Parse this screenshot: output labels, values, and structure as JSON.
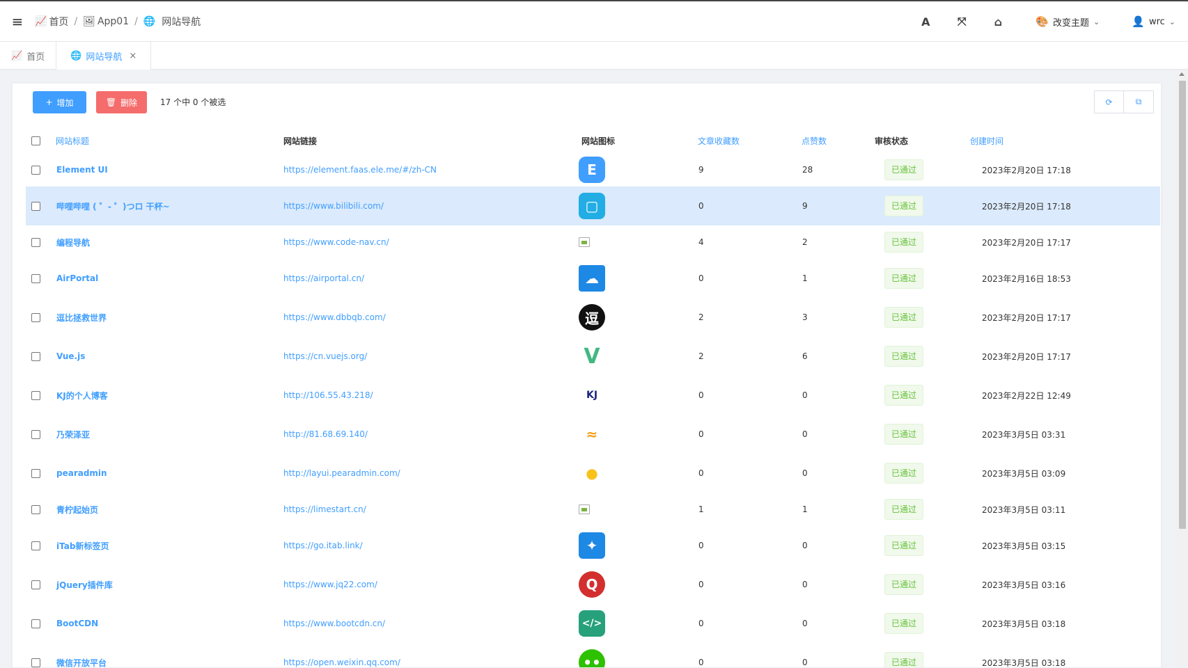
{
  "header": {
    "breadcrumb": [
      {
        "label": "首页",
        "icon": "chart-line-icon"
      },
      {
        "label": "App01",
        "icon": "image-icon"
      },
      {
        "label": "网站导航",
        "icon": "globe-icon"
      }
    ],
    "theme_label": "改变主题",
    "user_label": "wrc"
  },
  "tabs": [
    {
      "label": "首页",
      "icon": "chart-line-icon",
      "active": false
    },
    {
      "label": "网站导航",
      "icon": "globe-icon",
      "active": true
    }
  ],
  "toolbar": {
    "add_label": "增加",
    "delete_label": "删除",
    "selection_info": "17 个中 0 个被选"
  },
  "table": {
    "columns": [
      "网站标题",
      "网站链接",
      "网站图标",
      "文章收藏数",
      "点赞数",
      "审核状态",
      "创建时间"
    ],
    "rows": [
      {
        "title": "Element UI",
        "url": "https://element.faas.ele.me/#/zh-CN",
        "icon": "element-ui-logo",
        "favorites": "9",
        "likes": "28",
        "status": "已通过",
        "created": "2023年2月20日 17:18"
      },
      {
        "title": "哔哩哔哩 ( ゜- ゜)つロ 干杯~",
        "url": "https://www.bilibili.com/",
        "icon": "bilibili-logo",
        "favorites": "0",
        "likes": "9",
        "status": "已通过",
        "created": "2023年2月20日 17:18"
      },
      {
        "title": "编程导航",
        "url": "https://www.code-nav.cn/",
        "icon": "broken-image-icon",
        "favorites": "4",
        "likes": "2",
        "status": "已通过",
        "created": "2023年2月20日 17:17"
      },
      {
        "title": "AirPortal",
        "url": "https://airportal.cn/",
        "icon": "airportal-logo",
        "favorites": "0",
        "likes": "1",
        "status": "已通过",
        "created": "2023年2月16日 18:53"
      },
      {
        "title": "逗比拯救世界",
        "url": "https://www.dbbqb.com/",
        "icon": "dbbqb-logo",
        "favorites": "2",
        "likes": "3",
        "status": "已通过",
        "created": "2023年2月20日 17:17"
      },
      {
        "title": "Vue.js",
        "url": "https://cn.vuejs.org/",
        "icon": "vue-logo",
        "favorites": "2",
        "likes": "6",
        "status": "已通过",
        "created": "2023年2月20日 17:17"
      },
      {
        "title": "KJ的个人博客",
        "url": "http://106.55.43.218/",
        "icon": "kj-logo",
        "favorites": "0",
        "likes": "0",
        "status": "已通过",
        "created": "2023年2月22日 12:49"
      },
      {
        "title": "乃荣泽亚",
        "url": "http://81.68.69.140/",
        "icon": "nairong-logo",
        "favorites": "0",
        "likes": "0",
        "status": "已通过",
        "created": "2023年3月5日 03:31"
      },
      {
        "title": "pearadmin",
        "url": "http://layui.pearadmin.com/",
        "icon": "pear-logo",
        "favorites": "0",
        "likes": "0",
        "status": "已通过",
        "created": "2023年3月5日 03:09"
      },
      {
        "title": "青柠起始页",
        "url": "https://limestart.cn/",
        "icon": "broken-image-icon",
        "favorites": "1",
        "likes": "1",
        "status": "已通过",
        "created": "2023年3月5日 03:11"
      },
      {
        "title": "iTab新标签页",
        "url": "https://go.itab.link/",
        "icon": "itab-logo",
        "favorites": "0",
        "likes": "0",
        "status": "已通过",
        "created": "2023年3月5日 03:15"
      },
      {
        "title": "jQuery插件库",
        "url": "https://www.jq22.com/",
        "icon": "jq22-logo",
        "favorites": "0",
        "likes": "0",
        "status": "已通过",
        "created": "2023年3月5日 03:16"
      },
      {
        "title": "BootCDN",
        "url": "https://www.bootcdn.cn/",
        "icon": "bootcdn-logo",
        "favorites": "0",
        "likes": "0",
        "status": "已通过",
        "created": "2023年3月5日 03:18"
      },
      {
        "title": "微信开放平台",
        "url": "https://open.weixin.qq.com/",
        "icon": "wechat-logo",
        "favorites": "0",
        "likes": "0",
        "status": "已通过",
        "created": "2023年3月5日 03:18"
      }
    ]
  },
  "colors": {
    "primary": "#409eff",
    "danger": "#f56c6c",
    "success": "#67c23a",
    "highlight_row": "#dbeafc"
  }
}
